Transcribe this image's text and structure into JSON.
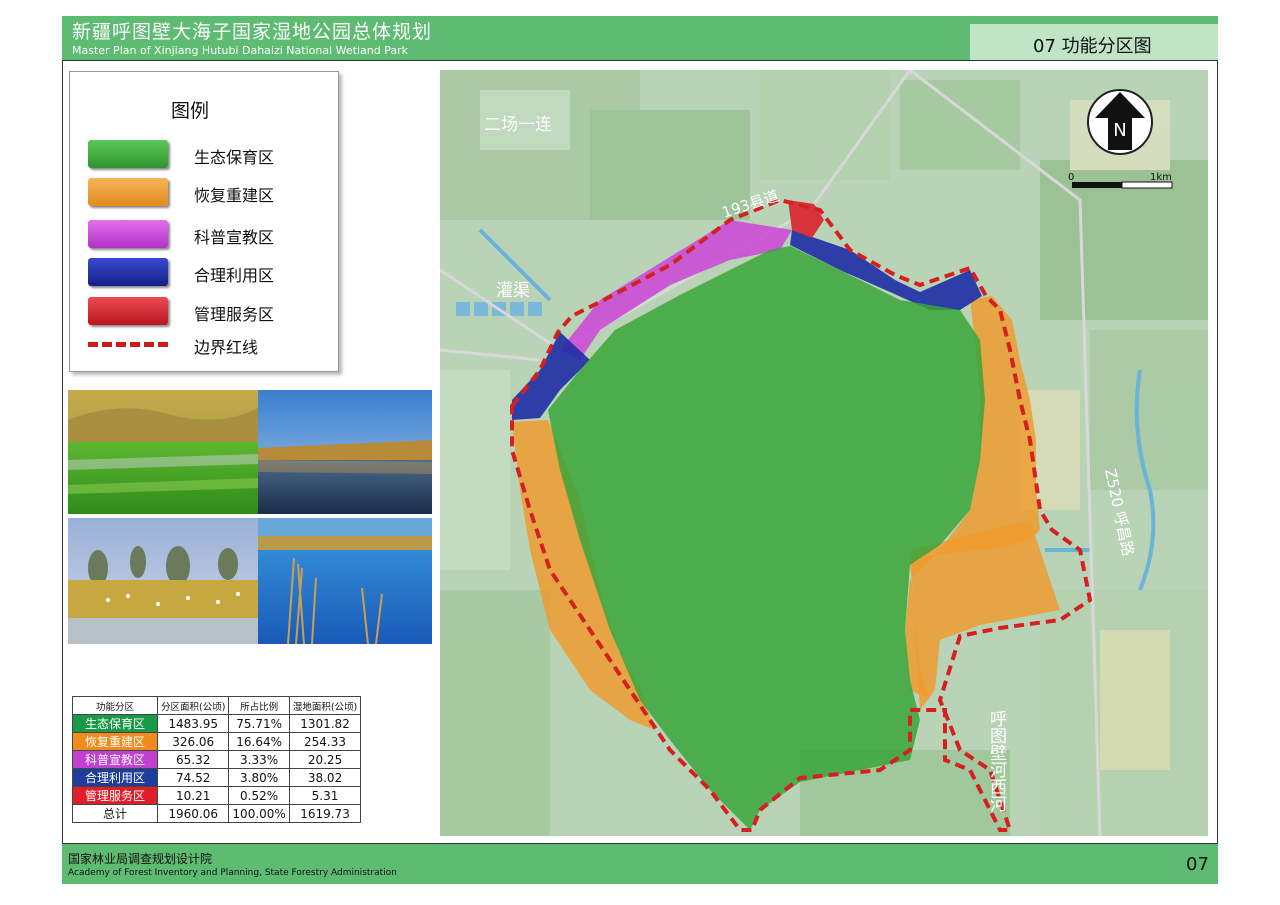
{
  "header": {
    "title_cn": "新疆呼图壁大海子国家湿地公园总体规划",
    "title_en": "Master Plan of Xinjiang Hutubi Dahaizi National Wetland Park",
    "sheet_title": "07 功能分区图"
  },
  "legend": {
    "title": "图例",
    "items": [
      {
        "label": "生态保育区",
        "color": "#3aa43a"
      },
      {
        "label": "恢复重建区",
        "color": "#f09a2c"
      },
      {
        "label": "科普宣教区",
        "color": "#cc44d8"
      },
      {
        "label": "合理利用区",
        "color": "#1e2da6"
      },
      {
        "label": "管理服务区",
        "color": "#d82a36"
      }
    ],
    "boundary_label": "边界红线",
    "boundary_color": "#cc1a1a"
  },
  "table": {
    "headers": [
      "功能分区",
      "分区面积(公顷)",
      "所占比例",
      "湿地面积(公顷)"
    ],
    "rows": [
      {
        "zone": "生态保育区",
        "area": "1483.95",
        "ratio": "75.71%",
        "wetland": "1301.82",
        "color": "#1a9a46"
      },
      {
        "zone": "恢复重建区",
        "area": "326.06",
        "ratio": "16.64%",
        "wetland": "254.33",
        "color": "#f08b1e"
      },
      {
        "zone": "科普宣教区",
        "area": "65.32",
        "ratio": "3.33%",
        "wetland": "20.25",
        "color": "#c040d0"
      },
      {
        "zone": "合理利用区",
        "area": "74.52",
        "ratio": "3.80%",
        "wetland": "38.02",
        "color": "#1e3c9a"
      },
      {
        "zone": "管理服务区",
        "area": "10.21",
        "ratio": "0.52%",
        "wetland": "5.31",
        "color": "#e01e2a"
      }
    ],
    "total": {
      "label": "总计",
      "area": "1960.06",
      "ratio": "100.00%",
      "wetland": "1619.73"
    }
  },
  "map": {
    "labels": {
      "place_erchang": "二场一连",
      "road_193": "193县道",
      "canal": "灌渠",
      "road_z520": "Z520 呼昌路",
      "river": "呼图壁河西河"
    },
    "north_letter": "N",
    "scale": {
      "start": "0",
      "end": "1km"
    }
  },
  "footer": {
    "org_cn": "国家林业局调查规划设计院",
    "org_en": "Academy of Forest Inventory and Planning, State Forestry Administration",
    "page": "07"
  }
}
